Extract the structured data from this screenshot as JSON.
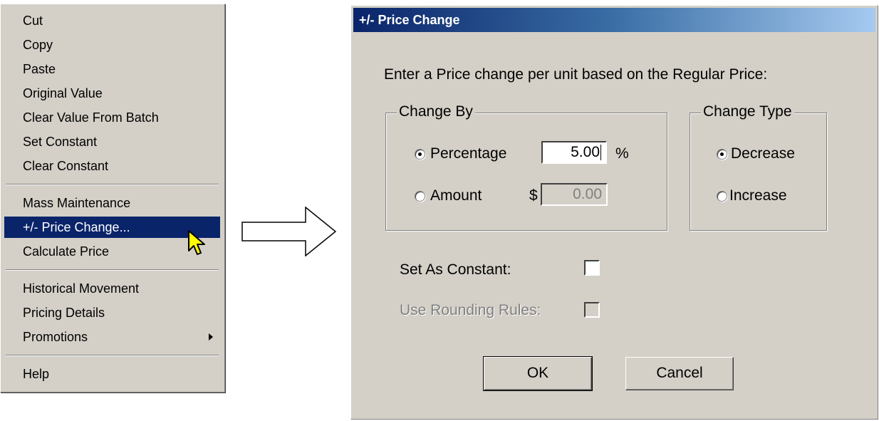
{
  "context_menu": {
    "items": [
      {
        "label": "Cut"
      },
      {
        "label": "Copy"
      },
      {
        "label": "Paste"
      },
      {
        "label": "Original Value"
      },
      {
        "label": "Clear Value From Batch"
      },
      {
        "label": "Set Constant"
      },
      {
        "label": "Clear Constant"
      },
      {
        "label": "Mass Maintenance"
      },
      {
        "label": "+/- Price Change..."
      },
      {
        "label": "Calculate Price"
      },
      {
        "label": "Historical Movement"
      },
      {
        "label": "Pricing Details"
      },
      {
        "label": "Promotions",
        "submenu_icon": "submenu-arrow-icon"
      },
      {
        "label": "Help"
      }
    ],
    "selected_index": 8,
    "colors": {
      "highlight": "#0a246a",
      "background": "#d4d0c8"
    }
  },
  "transition_icon": "right-arrow-icon",
  "dialog": {
    "title": "+/- Price Change",
    "prompt": "Enter a Price change per unit based on the Regular Price:",
    "change_by": {
      "legend": "Change By",
      "percentage_label": "Percentage",
      "percentage_value": "5.00",
      "percentage_unit": "%",
      "amount_label": "Amount",
      "amount_currency": "$",
      "amount_value": "0.00",
      "selected": "Percentage"
    },
    "change_type": {
      "legend": "Change Type",
      "decrease_label": "Decrease",
      "increase_label": "Increase",
      "selected": "Decrease"
    },
    "set_as_constant_label": "Set As Constant:",
    "use_rounding_rules_label": "Use Rounding Rules:",
    "ok_label": "OK",
    "cancel_label": "Cancel"
  }
}
